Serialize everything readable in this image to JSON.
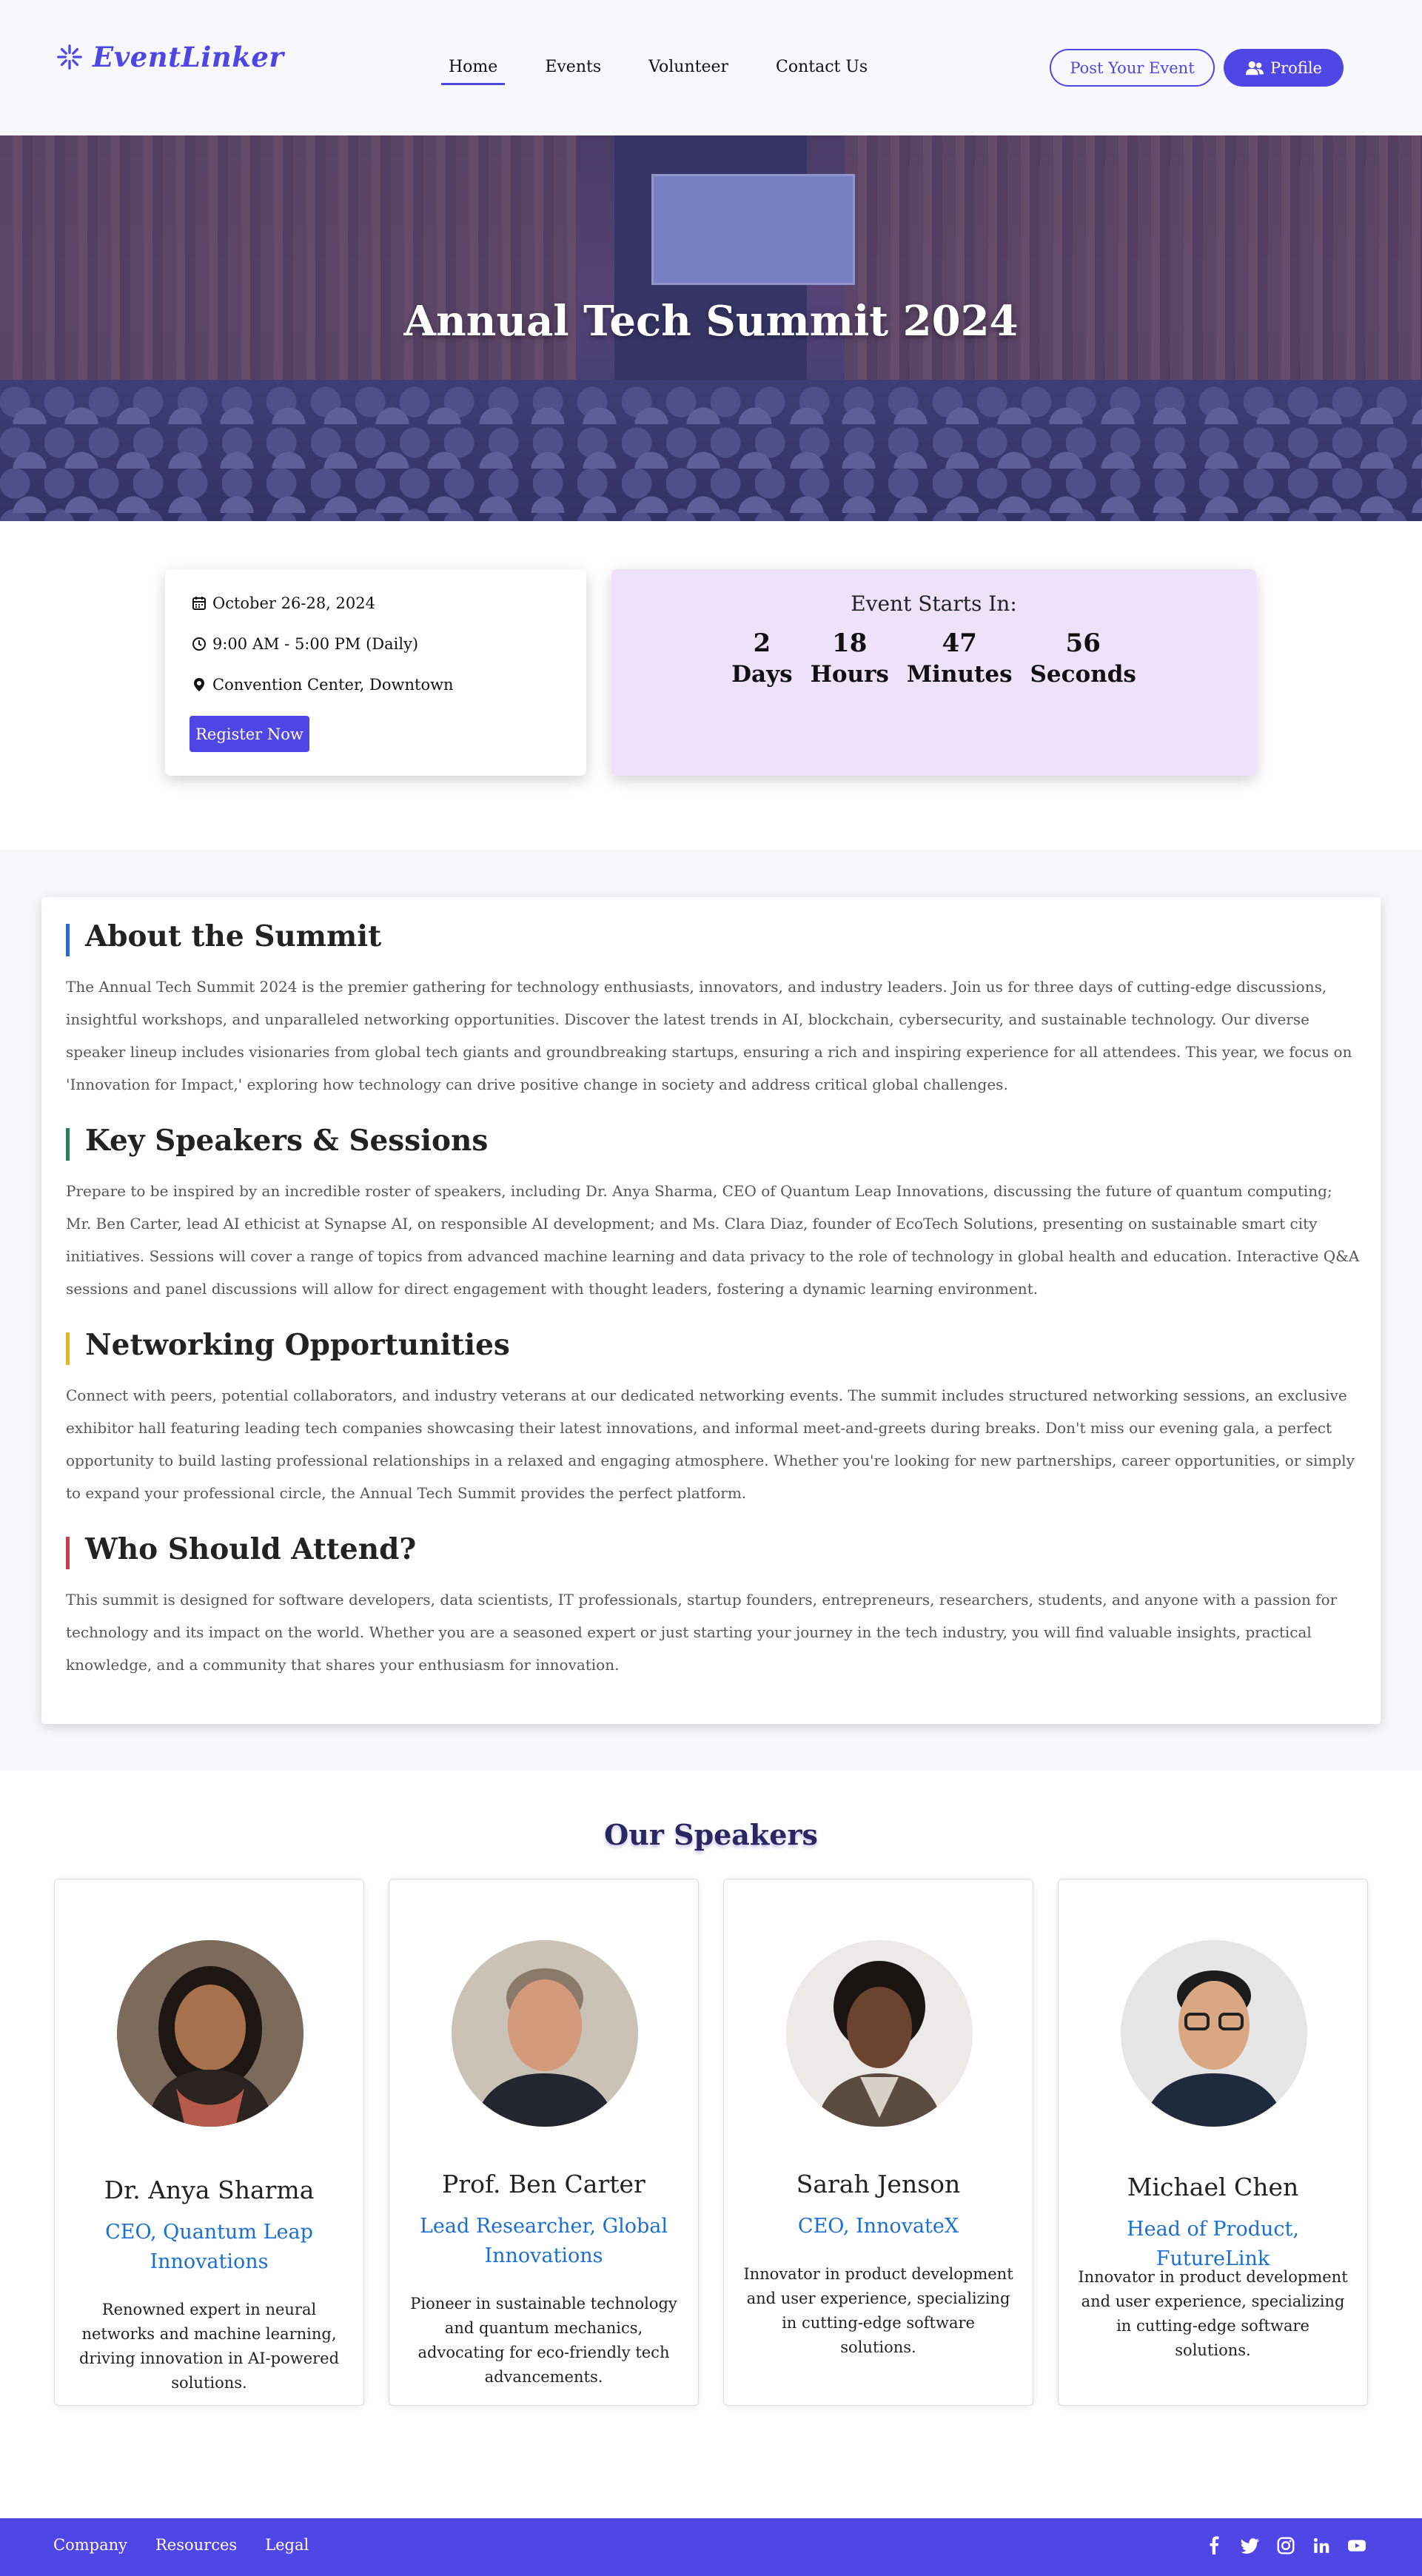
{
  "header": {
    "logo_text": "EventLinker",
    "nav": [
      {
        "label": "Home",
        "active": true
      },
      {
        "label": "Events",
        "active": false
      },
      {
        "label": "Volunteer",
        "active": false
      },
      {
        "label": "Contact Us",
        "active": false
      }
    ],
    "post_event_label": "Post Your Event",
    "profile_label": "Profile"
  },
  "hero": {
    "title": "Annual Tech Summit 2024"
  },
  "event_info": {
    "date": "October 26-28, 2024",
    "time": "9:00 AM - 5:00 PM (Daily)",
    "location": "Convention Center, Downtown",
    "register_label": "Register Now"
  },
  "countdown": {
    "title": "Event Starts In:",
    "units": [
      {
        "value": "2",
        "label": "Days"
      },
      {
        "value": "18",
        "label": "Hours"
      },
      {
        "value": "47",
        "label": "Minutes"
      },
      {
        "value": "56",
        "label": "Seconds"
      }
    ]
  },
  "about": {
    "sections": [
      {
        "heading": "About the Summit",
        "accent": "#1a6fd1",
        "body": "The Annual Tech Summit 2024 is the premier gathering for technology enthusiasts, innovators, and industry leaders. Join us for three days of cutting-edge discussions, insightful workshops, and unparalleled networking opportunities. Discover the latest trends in AI, blockchain, cybersecurity, and sustainable technology. Our diverse speaker lineup includes visionaries from global tech giants and groundbreaking startups, ensuring a rich and inspiring experience for all attendees. This year, we focus on 'Innovation for Impact,' exploring how technology can drive positive change in society and address critical global challenges."
      },
      {
        "heading": "Key Speakers & Sessions",
        "accent": "#198754",
        "body": "Prepare to be inspired by an incredible roster of speakers, including Dr. Anya Sharma, CEO of Quantum Leap Innovations, discussing the future of quantum computing; Mr. Ben Carter, lead AI ethicist at Synapse AI, on responsible AI development; and Ms. Clara Diaz, founder of EcoTech Solutions, presenting on sustainable smart city initiatives. Sessions will cover a range of topics from advanced machine learning and data privacy to the role of technology in global health and education. Interactive Q&A sessions and panel discussions will allow for direct engagement with thought leaders, fostering a dynamic learning environment."
      },
      {
        "heading": "Networking Opportunities",
        "accent": "#f0b400",
        "body": "Connect with peers, potential collaborators, and industry veterans at our dedicated networking events. The summit includes structured networking sessions, an exclusive exhibitor hall featuring leading tech companies showcasing their latest innovations, and informal meet-and-greets during breaks. Don't miss our evening gala, a perfect opportunity to build lasting professional relationships in a relaxed and engaging atmosphere. Whether you're looking for new partnerships, career opportunities, or simply to expand your professional circle, the Annual Tech Summit provides the perfect platform."
      },
      {
        "heading": "Who Should Attend?",
        "accent": "#dc3545",
        "body": "This summit is designed for software developers, data scientists, IT professionals, startup founders, entrepreneurs, researchers, students, and anyone with a passion for technology and its impact on the world. Whether you are a seasoned expert or just starting your journey in the tech industry, you will find valuable insights, practical knowledge, and a community that shares your enthusiasm for innovation."
      }
    ]
  },
  "speakers": {
    "title": "Our Speakers",
    "items": [
      {
        "name": "Dr. Anya Sharma",
        "role": "CEO, Quantum Leap Innovations",
        "bio": "Renowned expert in neural networks and machine learning, driving innovation in AI-powered solutions."
      },
      {
        "name": "Prof. Ben Carter",
        "role": "Lead Researcher, Global Innovations",
        "bio": "Pioneer in sustainable technology and quantum mechanics, advocating for eco-friendly tech advancements."
      },
      {
        "name": "Sarah Jenson",
        "role": "CEO, InnovateX",
        "bio": "Innovator in product development and user experience, specializing in cutting-edge software solutions."
      },
      {
        "name": "Michael Chen",
        "role": "Head of Product, FutureLink",
        "bio": "Innovator in product development and user experience, specializing in cutting-edge software solutions."
      }
    ]
  },
  "footer": {
    "links": [
      "Company",
      "Resources",
      "Legal"
    ],
    "social_icons": [
      "facebook-icon",
      "twitter-icon",
      "instagram-icon",
      "linkedin-icon",
      "youtube-icon"
    ]
  },
  "colors": {
    "brand": "#4f46e5",
    "countdown_bg": "#ede2fa",
    "speaker_role": "#1a6fd1"
  }
}
